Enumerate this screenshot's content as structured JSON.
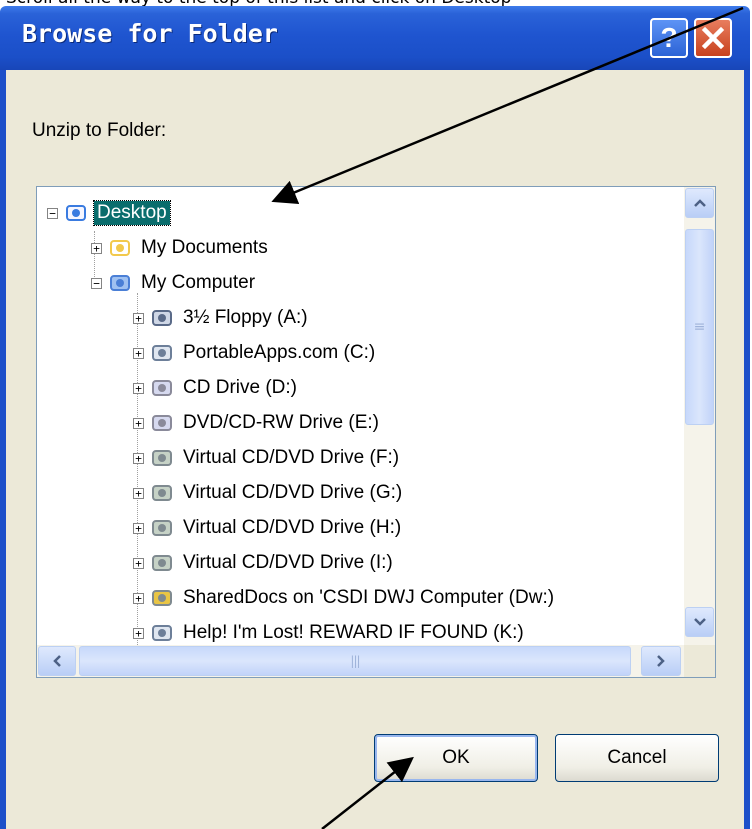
{
  "top_caption": "Scroll all the way to the top of this list and click on Desktop",
  "dialog": {
    "title": "Browse for Folder",
    "help_glyph": "?",
    "close_glyph": "✕",
    "prompt": "Unzip to Folder:"
  },
  "tree": {
    "items": [
      {
        "label": "Desktop",
        "expander": "−",
        "icon": "desktop-icon",
        "selected": true
      },
      {
        "label": "My Documents",
        "expander": "+",
        "icon": "my-documents-icon"
      },
      {
        "label": "My Computer",
        "expander": "−",
        "icon": "my-computer-icon"
      },
      {
        "label": "3½ Floppy (A:)",
        "expander": "+",
        "icon": "floppy-drive-icon"
      },
      {
        "label": "PortableApps.com (C:)",
        "expander": "+",
        "icon": "portableapps-drive-icon"
      },
      {
        "label": "CD Drive (D:)",
        "expander": "+",
        "icon": "cd-drive-icon"
      },
      {
        "label": "DVD/CD-RW Drive (E:)",
        "expander": "+",
        "icon": "dvd-drive-icon"
      },
      {
        "label": "Virtual CD/DVD Drive (F:)",
        "expander": "+",
        "icon": "virtual-drive-icon"
      },
      {
        "label": "Virtual CD/DVD Drive (G:)",
        "expander": "+",
        "icon": "virtual-drive-icon"
      },
      {
        "label": "Virtual CD/DVD Drive (H:)",
        "expander": "+",
        "icon": "virtual-drive-icon"
      },
      {
        "label": "Virtual CD/DVD Drive (I:)",
        "expander": "+",
        "icon": "virtual-drive-icon"
      },
      {
        "label": "SharedDocs on 'CSDI DWJ Computer (Dw:)",
        "expander": "+",
        "icon": "network-share-icon"
      },
      {
        "label": "Help! I'm Lost!  REWARD IF FOUND (K:)",
        "expander": "+",
        "icon": "removable-drive-icon"
      }
    ]
  },
  "scrollbars": {
    "up": "▲",
    "down": "▼",
    "left": "◀",
    "right": "▶",
    "grip_v": "≡",
    "grip_h": "|||"
  },
  "buttons": {
    "ok": "OK",
    "cancel": "Cancel"
  },
  "colors": {
    "titlebar": "#1f55d0",
    "client": "#ece9d8",
    "selection": "#0a6d6d",
    "close": "#c8421d"
  }
}
